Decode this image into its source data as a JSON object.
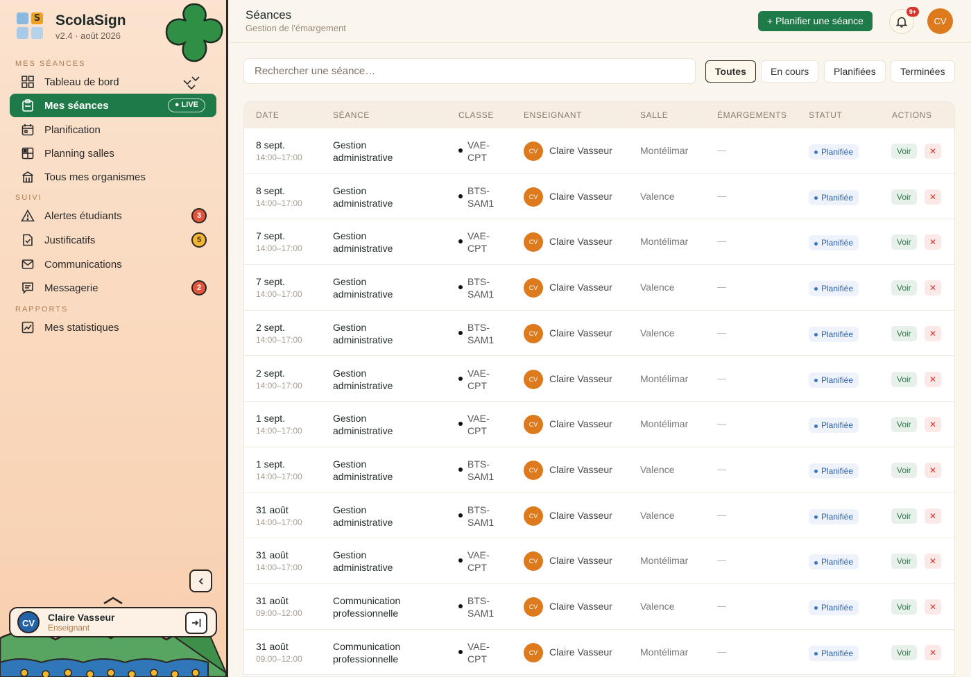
{
  "brand": {
    "name": "ScolaSign",
    "version": "v2.4 · août 2026",
    "logo_letter": "S"
  },
  "sidebar": {
    "sections": [
      "MES SÉANCES",
      "SUIVI",
      "RAPPORTS"
    ],
    "items": [
      {
        "label": "Tableau de bord",
        "icon": "grid-icon"
      },
      {
        "label": "Mes séances",
        "icon": "clipboard-icon",
        "badge": "● LIVE",
        "active": true
      },
      {
        "label": "Planification",
        "icon": "calendar-icon"
      },
      {
        "label": "Planning salles",
        "icon": "rooms-grid-icon"
      },
      {
        "label": "Tous mes organismes",
        "icon": "building-icon"
      },
      {
        "label": "Alertes étudiants",
        "icon": "warning-icon",
        "count": "3"
      },
      {
        "label": "Justificatifs",
        "icon": "document-check-icon",
        "count": "5"
      },
      {
        "label": "Communications",
        "icon": "mail-icon"
      },
      {
        "label": "Messagerie",
        "icon": "chat-icon",
        "count": "2"
      },
      {
        "label": "Mes statistiques",
        "icon": "chart-icon"
      }
    ]
  },
  "user": {
    "initials": "CV",
    "name": "Claire Vasseur",
    "role": "Enseignant"
  },
  "header": {
    "title": "Séances",
    "subtitle": "Gestion de l'émargement",
    "plan_button": "+  Planifier une séance",
    "notif_badge": "9+",
    "avatar": "CV"
  },
  "search": {
    "placeholder": "Rechercher une séance…"
  },
  "filters": [
    "Toutes",
    "En cours",
    "Planifiées",
    "Terminées"
  ],
  "table": {
    "columns": [
      "DATE",
      "SÉANCE",
      "CLASSE",
      "ENSEIGNANT",
      "SALLE",
      "ÉMARGEMENTS",
      "STATUT",
      "ACTIONS"
    ],
    "rows": [
      {
        "date": "8 sept.",
        "time": "14:00–17:00",
        "seance1": "Gestion",
        "seance2": "administrative",
        "classe1": "VAE-",
        "classe2": "CPT",
        "av": "CV",
        "teacher": "Claire Vasseur",
        "salle": "Montélimar",
        "emarg": "—",
        "status": "Planifiée",
        "voir": "Voir",
        "del": "✕"
      },
      {
        "date": "8 sept.",
        "time": "14:00–17:00",
        "seance1": "Gestion",
        "seance2": "administrative",
        "classe1": "BTS-",
        "classe2": "SAM1",
        "av": "CV",
        "teacher": "Claire Vasseur",
        "salle": "Valence",
        "emarg": "—",
        "status": "Planifiée",
        "voir": "Voir",
        "del": "✕"
      },
      {
        "date": "7 sept.",
        "time": "14:00–17:00",
        "seance1": "Gestion",
        "seance2": "administrative",
        "classe1": "VAE-",
        "classe2": "CPT",
        "av": "CV",
        "teacher": "Claire Vasseur",
        "salle": "Montélimar",
        "emarg": "—",
        "status": "Planifiée",
        "voir": "Voir",
        "del": "✕"
      },
      {
        "date": "7 sept.",
        "time": "14:00–17:00",
        "seance1": "Gestion",
        "seance2": "administrative",
        "classe1": "BTS-",
        "classe2": "SAM1",
        "av": "CV",
        "teacher": "Claire Vasseur",
        "salle": "Valence",
        "emarg": "—",
        "status": "Planifiée",
        "voir": "Voir",
        "del": "✕"
      },
      {
        "date": "2 sept.",
        "time": "14:00–17:00",
        "seance1": "Gestion",
        "seance2": "administrative",
        "classe1": "BTS-",
        "classe2": "SAM1",
        "av": "CV",
        "teacher": "Claire Vasseur",
        "salle": "Valence",
        "emarg": "—",
        "status": "Planifiée",
        "voir": "Voir",
        "del": "✕"
      },
      {
        "date": "2 sept.",
        "time": "14:00–17:00",
        "seance1": "Gestion",
        "seance2": "administrative",
        "classe1": "VAE-",
        "classe2": "CPT",
        "av": "CV",
        "teacher": "Claire Vasseur",
        "salle": "Montélimar",
        "emarg": "—",
        "status": "Planifiée",
        "voir": "Voir",
        "del": "✕"
      },
      {
        "date": "1 sept.",
        "time": "14:00–17:00",
        "seance1": "Gestion",
        "seance2": "administrative",
        "classe1": "VAE-",
        "classe2": "CPT",
        "av": "CV",
        "teacher": "Claire Vasseur",
        "salle": "Montélimar",
        "emarg": "—",
        "status": "Planifiée",
        "voir": "Voir",
        "del": "✕"
      },
      {
        "date": "1 sept.",
        "time": "14:00–17:00",
        "seance1": "Gestion",
        "seance2": "administrative",
        "classe1": "BTS-",
        "classe2": "SAM1",
        "av": "CV",
        "teacher": "Claire Vasseur",
        "salle": "Valence",
        "emarg": "—",
        "status": "Planifiée",
        "voir": "Voir",
        "del": "✕"
      },
      {
        "date": "31 août",
        "time": "14:00–17:00",
        "seance1": "Gestion",
        "seance2": "administrative",
        "classe1": "BTS-",
        "classe2": "SAM1",
        "av": "CV",
        "teacher": "Claire Vasseur",
        "salle": "Valence",
        "emarg": "—",
        "status": "Planifiée",
        "voir": "Voir",
        "del": "✕"
      },
      {
        "date": "31 août",
        "time": "14:00–17:00",
        "seance1": "Gestion",
        "seance2": "administrative",
        "classe1": "VAE-",
        "classe2": "CPT",
        "av": "CV",
        "teacher": "Claire Vasseur",
        "salle": "Montélimar",
        "emarg": "—",
        "status": "Planifiée",
        "voir": "Voir",
        "del": "✕"
      },
      {
        "date": "31 août",
        "time": "09:00–12:00",
        "seance1": "Communication",
        "seance2": "professionnelle",
        "classe1": "BTS-",
        "classe2": "SAM1",
        "av": "CV",
        "teacher": "Claire Vasseur",
        "salle": "Valence",
        "emarg": "—",
        "status": "Planifiée",
        "voir": "Voir",
        "del": "✕"
      },
      {
        "date": "31 août",
        "time": "09:00–12:00",
        "seance1": "Communication",
        "seance2": "professionnelle",
        "classe1": "VAE-",
        "classe2": "CPT",
        "av": "CV",
        "teacher": "Claire Vasseur",
        "salle": "Montélimar",
        "emarg": "—",
        "status": "Planifiée",
        "voir": "Voir",
        "del": "✕"
      }
    ]
  },
  "colors": {
    "accent": "#1e7a48",
    "avatar": "#dc7a1d",
    "badge_red": "#e2553c",
    "badge_yellow": "#f2b632",
    "status_blue": "#2b5fa8"
  }
}
